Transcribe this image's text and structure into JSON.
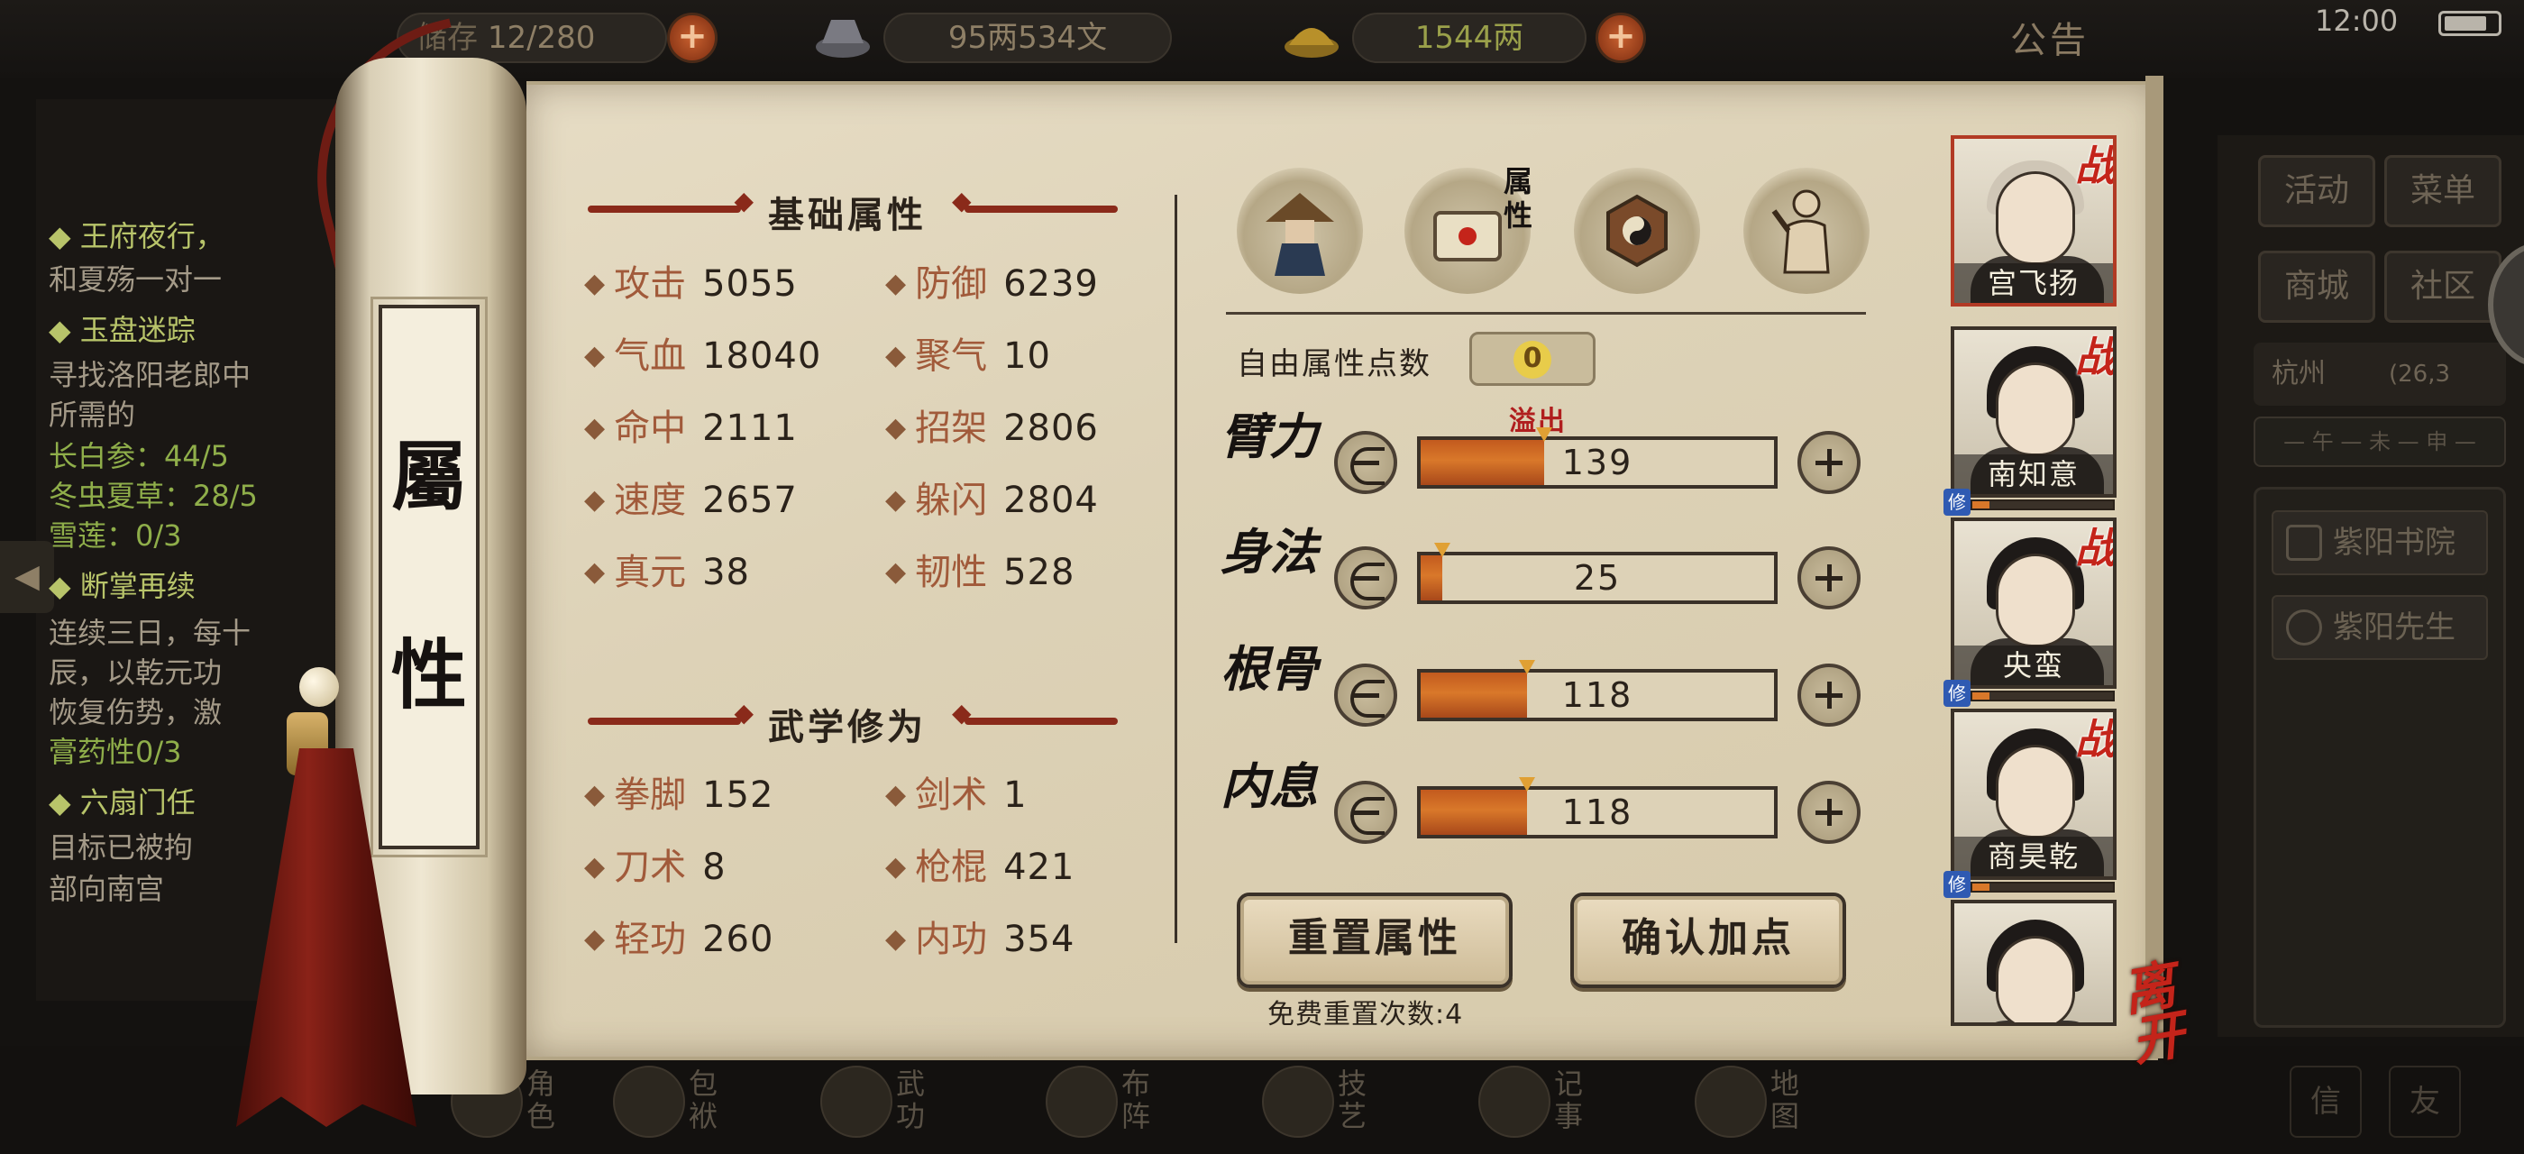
{
  "top_bar": {
    "resource1_label": "储存",
    "resource1_value": "12/280",
    "silver": "95两534文",
    "gold": "1544两",
    "notice": "公告",
    "clock": "12:00"
  },
  "quest_panel": {
    "lines": [
      {
        "text": "◆ 王府夜行，",
        "kind": "title"
      },
      {
        "text": "和夏殇一对一",
        "kind": "body"
      },
      {
        "text": "◆ 玉盘迷踪",
        "kind": "title"
      },
      {
        "text": "寻找洛阳老郎中",
        "kind": "body"
      },
      {
        "text": "所需的",
        "kind": "body"
      },
      {
        "text": "长白参：44/5",
        "kind": "item"
      },
      {
        "text": "冬虫夏草：28/5",
        "kind": "item"
      },
      {
        "text": "雪莲：0/3",
        "kind": "item"
      },
      {
        "text": "◆ 断掌再续",
        "kind": "title"
      },
      {
        "text": "连续三日，每十",
        "kind": "body"
      },
      {
        "text": "辰，以乾元功",
        "kind": "body"
      },
      {
        "text": "恢复伤势，激",
        "kind": "body"
      },
      {
        "text": "膏药性0/3",
        "kind": "item"
      },
      {
        "text": "◆ 六扇门任",
        "kind": "title"
      },
      {
        "text": "目标已被拘",
        "kind": "body"
      },
      {
        "text": "部向南宫",
        "kind": "body"
      }
    ]
  },
  "scroll_title": [
    "屬",
    "性"
  ],
  "basic_attributes": {
    "title": "基础属性",
    "stats": [
      {
        "name": "攻击",
        "value": "5055"
      },
      {
        "name": "防御",
        "value": "6239"
      },
      {
        "name": "气血",
        "value": "18040"
      },
      {
        "name": "聚气",
        "value": "10"
      },
      {
        "name": "命中",
        "value": "2111"
      },
      {
        "name": "招架",
        "value": "2806"
      },
      {
        "name": "速度",
        "value": "2657"
      },
      {
        "name": "躲闪",
        "value": "2804"
      },
      {
        "name": "真元",
        "value": "38"
      },
      {
        "name": "韧性",
        "value": "528"
      }
    ]
  },
  "martial_cultivation": {
    "title": "武学修为",
    "stats": [
      {
        "name": "拳脚",
        "value": "152"
      },
      {
        "name": "剑术",
        "value": "1"
      },
      {
        "name": "刀术",
        "value": "8"
      },
      {
        "name": "枪棍",
        "value": "421"
      },
      {
        "name": "轻功",
        "value": "260"
      },
      {
        "name": "内功",
        "value": "354"
      }
    ]
  },
  "tabs": [
    {
      "icon": "character-hat-icon"
    },
    {
      "icon": "attribute-scroll-icon",
      "label": "属性",
      "selected": true
    },
    {
      "icon": "bagua-icon"
    },
    {
      "icon": "meridian-figure-icon"
    }
  ],
  "free_points": {
    "label": "自由属性点数",
    "value": "0"
  },
  "overflow_label": "溢出",
  "attributes": [
    {
      "label": "臂力",
      "value": "139",
      "fill": 0.35
    },
    {
      "label": "身法",
      "value": "25",
      "fill": 0.06
    },
    {
      "label": "根骨",
      "value": "118",
      "fill": 0.3
    },
    {
      "label": "内息",
      "value": "118",
      "fill": 0.3
    }
  ],
  "buttons": {
    "reset": "重置属性",
    "confirm": "确认加点",
    "reset_count": "免费重置次数:4"
  },
  "party": [
    {
      "name": "宫飞扬",
      "battle_tag": "战",
      "selected": true
    },
    {
      "name": "南知意",
      "battle_tag": "战",
      "cultivate_tag": "修"
    },
    {
      "name": "央蛮",
      "battle_tag": "战",
      "cultivate_tag": "修"
    },
    {
      "name": "商昊乾",
      "battle_tag": "战",
      "cultivate_tag": "修"
    },
    {
      "name": ""
    }
  ],
  "leave_button": "离开",
  "right_panel": {
    "buttons": [
      "活动",
      "菜单",
      "商城",
      "社区"
    ],
    "location": "杭州",
    "coords": "(26,3",
    "compass": "— 午 — 未 — 申 —",
    "map_items": [
      "紫阳书院",
      "紫阳先生"
    ]
  },
  "bottom_nav": [
    {
      "label": "角色",
      "icon": "character-nav-icon"
    },
    {
      "label": "包袱",
      "icon": "bag-nav-icon"
    },
    {
      "label": "武功",
      "icon": "martial-arts-nav-icon"
    },
    {
      "label": "布阵",
      "icon": "formation-nav-icon"
    },
    {
      "label": "技艺",
      "icon": "skills-nav-icon"
    },
    {
      "label": "记事",
      "icon": "journal-nav-icon"
    },
    {
      "label": "地图",
      "icon": "map-nav-icon"
    }
  ],
  "bottom_small": [
    "信",
    "友"
  ],
  "colors": {
    "accent_red": "#c4241a",
    "parchment": "#e6dcc4",
    "bar_fill": "#d9782a",
    "attr_name": "#a15a3a"
  }
}
